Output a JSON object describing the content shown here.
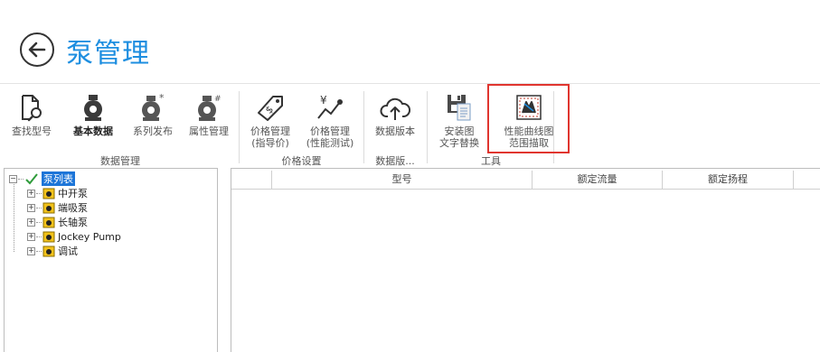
{
  "header": {
    "title": "泵管理",
    "back_icon": "arrow-left-icon"
  },
  "ribbon": {
    "buttons": [
      {
        "label": "查找型号",
        "icon": "search-document-icon"
      },
      {
        "label": "基本数据",
        "icon": "pump-icon"
      },
      {
        "label": "系列发布",
        "icon": "pump-star-icon"
      },
      {
        "label": "属性管理",
        "icon": "pump-hash-icon"
      },
      {
        "label": "价格管理",
        "sub": "(指导价)",
        "icon": "price-tag-icon"
      },
      {
        "label": "价格管理",
        "sub": "(性能测试)",
        "icon": "price-chart-icon"
      },
      {
        "label": "数据版本",
        "icon": "cloud-upload-icon"
      },
      {
        "label": "安装图",
        "sub": "文字替换",
        "icon": "save-document-icon"
      },
      {
        "label": "性能曲线图",
        "sub": "范围描取",
        "icon": "curve-capture-icon"
      }
    ],
    "groups": [
      "数据管理",
      "价格设置",
      "数据版...",
      "工具"
    ],
    "highlight_color": "#e0352f"
  },
  "tree": {
    "root": "泵列表",
    "items": [
      "中开泵",
      "端吸泵",
      "长轴泵",
      "Jockey Pump",
      "调试"
    ]
  },
  "grid": {
    "columns": [
      "",
      "型号",
      "额定流量",
      "额定扬程"
    ]
  }
}
